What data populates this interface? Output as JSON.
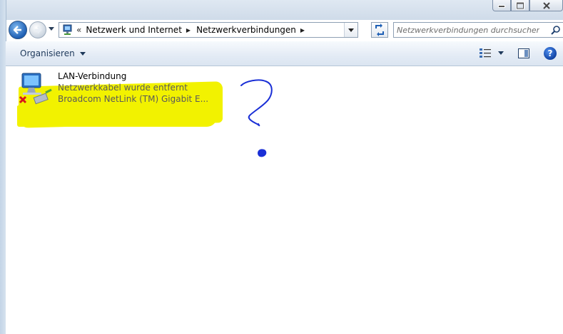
{
  "window": {
    "caption_buttons": [
      "minimize",
      "maximize",
      "close"
    ]
  },
  "navigation": {
    "back_icon": "back-arrow-icon",
    "forward_icon": "forward-arrow-icon",
    "breadcrumb_lead": "«",
    "breadcrumbs": [
      "Netzwerk und Internet",
      "Netzwerkverbindungen"
    ],
    "search_placeholder": "Netzwerkverbindungen durchsuchen"
  },
  "commandbar": {
    "organize_label": "Organisieren",
    "help_label": "?"
  },
  "connections": [
    {
      "name": "LAN-Verbindung",
      "status": "Netzwerkkabel wurde entfernt",
      "device": "Broadcom NetLink (TM) Gigabit E...",
      "icon": "network-disconnected-icon"
    }
  ],
  "annotations": {
    "highlight_color": "#f2f200",
    "pen_color": "#1a2fd6",
    "marks": [
      "question-mark",
      "dot"
    ]
  },
  "colors": {
    "frame": "#d6e2ef",
    "commandbar_text": "#1e395b",
    "status_text": "#5a5a5a"
  }
}
